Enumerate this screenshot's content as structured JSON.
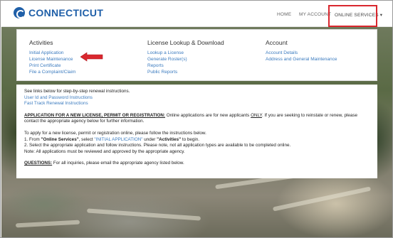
{
  "header": {
    "logo_text": "CONNECTICUT",
    "nav": {
      "home": "HOME",
      "account": "MY ACCOUNT",
      "services": "ONLINE SERVICES ▾"
    }
  },
  "dropdown": {
    "columns": [
      {
        "title": "Activities",
        "links": [
          "Initial Application",
          "License Maintenance",
          "Print Certificate",
          "File a Complaint/Claim"
        ]
      },
      {
        "title": "License Lookup & Download",
        "links": [
          "Lookup a License",
          "Generate Roster(s)",
          "Reports",
          "Public Reports"
        ]
      },
      {
        "title": "Account",
        "links": [
          "Account Details",
          "Address and General Maintenance"
        ]
      }
    ]
  },
  "content": {
    "intro": "See links below for step-by-step renewal instructions.",
    "link_user_id": "User Id and Password Instructions",
    "link_fast_track": "Fast Track Renewal Instructions",
    "new_license_heading": "APPLICATION FOR A NEW LICENSE, PERMIT OR REGISTRATION:",
    "new_license_text_a": " Online applications are for new applicants ",
    "new_license_only": "ONLY",
    "new_license_text_b": ". If you are seeking to reinstate or renew, please contact the appropriate agency below for further information.",
    "apply_intro": "To apply for a new license, permit or registration online, please follow the instructions below.",
    "step1_a": "1. From ",
    "step1_services": "\"Online Services\"",
    "step1_b": ", select ",
    "step1_initial": "\"INITIAL APPLICATION\"",
    "step1_c": " under ",
    "step1_activities": "\"Activities\"",
    "step1_d": " to begin.",
    "step2": "2. Select the appropriate application and follow instructions. Please note, not all application types are available to be completed online.",
    "note": "Note: All applications must be reviewed and approved by the appropriate agency.",
    "questions_heading": "QUESTIONS:",
    "questions_text": " For all inquiries, please email the appropriate agency listed below."
  },
  "colors": {
    "brand_blue": "#1f5fa8",
    "link_blue": "#3b7bbf",
    "highlight_red": "#d9272e"
  },
  "icons": {
    "logo": "connecticut-logo-icon",
    "arrow": "red-pointer-arrow-icon"
  }
}
